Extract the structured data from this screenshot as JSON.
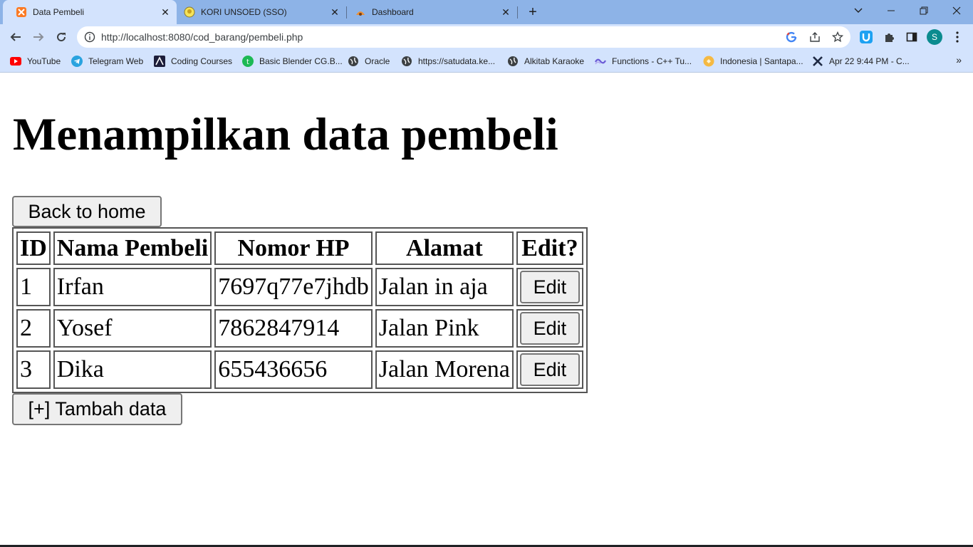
{
  "browser": {
    "tabs": [
      {
        "title": "Data Pembeli",
        "icon": "xampp-icon",
        "active": true
      },
      {
        "title": "KORI UNSOED (SSO)",
        "icon": "kori-icon",
        "active": false
      },
      {
        "title": "Dashboard",
        "icon": "dashboard-icon",
        "active": false
      }
    ],
    "url": "http://localhost:8080/cod_barang/pembeli.php",
    "profile_initial": "S",
    "bookmarks": [
      {
        "label": "YouTube",
        "icon": "youtube-icon"
      },
      {
        "label": "Telegram Web",
        "icon": "telegram-icon"
      },
      {
        "label": "Coding Courses",
        "icon": "coding-icon"
      },
      {
        "label": "Basic Blender CG.B...",
        "icon": "blender-icon"
      },
      {
        "label": "Oracle",
        "icon": "globe-icon"
      },
      {
        "label": "https://satudata.ke...",
        "icon": "globe-icon"
      },
      {
        "label": "Alkitab Karaoke",
        "icon": "globe-icon"
      },
      {
        "label": "Functions - C++ Tu...",
        "icon": "cpp-icon"
      },
      {
        "label": "Indonesia | Santapa...",
        "icon": "santapan-icon"
      },
      {
        "label": "Apr 22 9:44 PM - C...",
        "icon": "capcut-icon"
      }
    ],
    "more_bookmarks": "»",
    "colors": {
      "tabstrip": "#8db3e7",
      "toolbar": "#d3e3fd"
    }
  },
  "page": {
    "heading": "Menampilkan data pembeli",
    "back_button": "Back to home",
    "add_button": "[+] Tambah data",
    "table": {
      "headers": [
        "ID",
        "Nama Pembeli",
        "Nomor HP",
        "Alamat",
        "Edit?"
      ],
      "rows": [
        {
          "id": "1",
          "nama": "Irfan",
          "hp": "7697q77e7jhdb",
          "alamat": "Jalan in aja",
          "edit": "Edit"
        },
        {
          "id": "2",
          "nama": "Yosef",
          "hp": "7862847914",
          "alamat": "Jalan Pink",
          "edit": "Edit"
        },
        {
          "id": "3",
          "nama": "Dika",
          "hp": "655436656",
          "alamat": "Jalan Morena",
          "edit": "Edit"
        }
      ]
    }
  }
}
